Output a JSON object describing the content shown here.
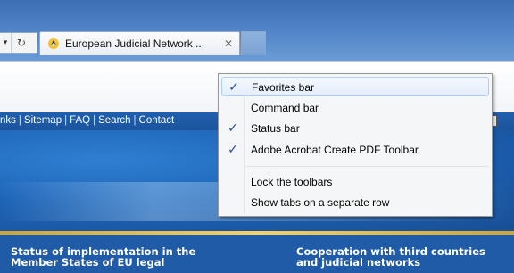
{
  "browser": {
    "tab_title": "European Judicial Network ...",
    "close_glyph": "✕",
    "refresh_glyph": "↻",
    "dropdown_glyph": "▾"
  },
  "site": {
    "nav_links": [
      "nks",
      "Sitemap",
      "FAQ",
      "Search",
      "Contact"
    ],
    "language_selector": "∨",
    "panel_left_line1": "Status of implementation in the",
    "panel_left_line2": "Member States of EU legal",
    "panel_right_line1": "Cooperation with third countries",
    "panel_right_line2": "and judicial networks"
  },
  "context_menu": {
    "items": [
      {
        "label": "Favorites bar",
        "checked": true
      },
      {
        "label": "Command bar",
        "checked": false
      },
      {
        "label": "Status bar",
        "checked": true
      },
      {
        "label": "Adobe Acrobat Create PDF Toolbar",
        "checked": true
      },
      {
        "label": "Lock the toolbars",
        "checked": false
      },
      {
        "label": "Show tabs on a separate row",
        "checked": false
      }
    ],
    "check_glyph": "✓",
    "highlight_color": "#aecff7"
  }
}
